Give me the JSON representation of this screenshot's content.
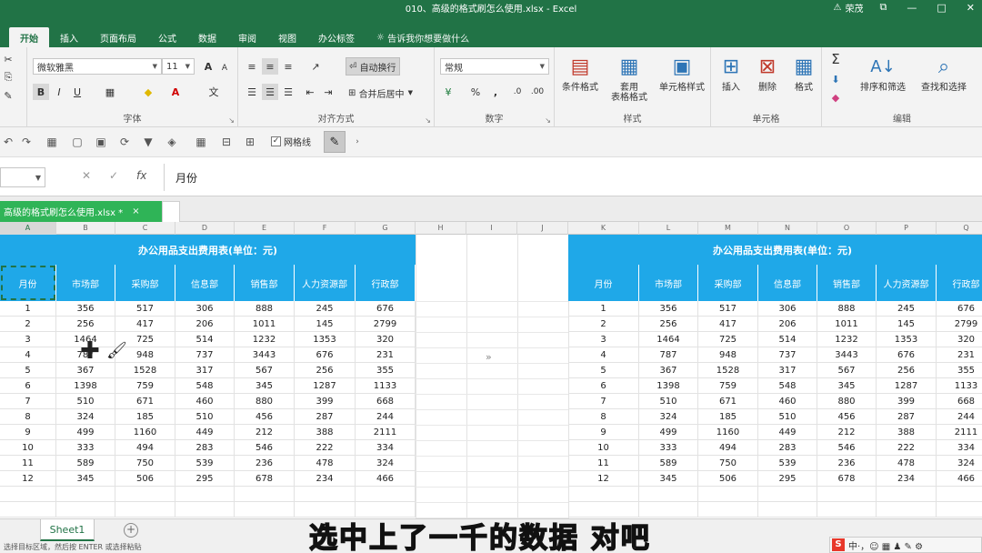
{
  "window": {
    "title": "010、高级的格式刷怎么使用.xlsx  -  Excel",
    "user": "荣茂",
    "restore_glyph": "⧉",
    "minimize_glyph": "—",
    "maximize_glyph": "□",
    "close_glyph": "✕"
  },
  "tabs": [
    "开始",
    "插入",
    "页面布局",
    "公式",
    "数据",
    "审阅",
    "视图",
    "办公标签"
  ],
  "tell_me": "告诉我你想要做什么",
  "ribbon": {
    "font_name": "微软雅黑",
    "font_size": "11",
    "grow_font": "A",
    "shrink_font": "A",
    "bold": "B",
    "italic": "I",
    "underline": "U",
    "wrap_text": "自动换行",
    "merge_center": "合并后居中",
    "number_format": "常规",
    "percent": "%",
    "comma": ",",
    "conditional_format": "条件格式",
    "format_as_table": "套用\n表格格式",
    "cell_styles": "单元格样式",
    "insert": "插入",
    "delete": "删除",
    "format": "格式",
    "sum": "Σ",
    "sort_filter": "排序和筛选",
    "find_select": "查找和选择",
    "group_font": "字体",
    "group_alignment": "对齐方式",
    "group_number": "数字",
    "group_styles": "样式",
    "group_cells": "单元格",
    "group_editing": "编辑"
  },
  "qat": {
    "gridlines_label": "网格线"
  },
  "formula_bar": {
    "content": "月份",
    "cancel": "✕",
    "enter": "✓",
    "fx": "fx"
  },
  "workbook_tab": {
    "name": "高级的格式刷怎么使用.xlsx *",
    "close": "×"
  },
  "columns": [
    "A",
    "B",
    "C",
    "D",
    "E",
    "F",
    "G",
    "H",
    "I",
    "J",
    "K",
    "L",
    "M",
    "N",
    "O",
    "P",
    "Q"
  ],
  "table": {
    "title": "办公用品支出费用表(单位：元)",
    "headers": [
      "月份",
      "市场部",
      "采购部",
      "信息部",
      "销售部",
      "人力资源部",
      "行政部"
    ],
    "rows": [
      [
        "1",
        "356",
        "517",
        "306",
        "888",
        "245",
        "676"
      ],
      [
        "2",
        "256",
        "417",
        "206",
        "1011",
        "145",
        "2799"
      ],
      [
        "3",
        "1464",
        "725",
        "514",
        "1232",
        "1353",
        "320"
      ],
      [
        "4",
        "787",
        "948",
        "737",
        "3443",
        "676",
        "231"
      ],
      [
        "5",
        "367",
        "1528",
        "317",
        "567",
        "256",
        "355"
      ],
      [
        "6",
        "1398",
        "759",
        "548",
        "345",
        "1287",
        "1133"
      ],
      [
        "7",
        "510",
        "671",
        "460",
        "880",
        "399",
        "668"
      ],
      [
        "8",
        "324",
        "185",
        "510",
        "456",
        "287",
        "244"
      ],
      [
        "9",
        "499",
        "1160",
        "449",
        "212",
        "388",
        "2111"
      ],
      [
        "10",
        "333",
        "494",
        "283",
        "546",
        "222",
        "334"
      ],
      [
        "11",
        "589",
        "750",
        "539",
        "236",
        "478",
        "324"
      ],
      [
        "12",
        "345",
        "506",
        "295",
        "678",
        "234",
        "466"
      ]
    ]
  },
  "arrows_text": "»",
  "sheet_tab": "Sheet1",
  "add_sheet": "+",
  "status_text": "选择目标区域，然后按 ENTER 或选择粘贴",
  "subtitle": "选中上了一千的数据 对吧",
  "ime_text": "中·，☺ ▦ ♟ ✎ ⚙"
}
